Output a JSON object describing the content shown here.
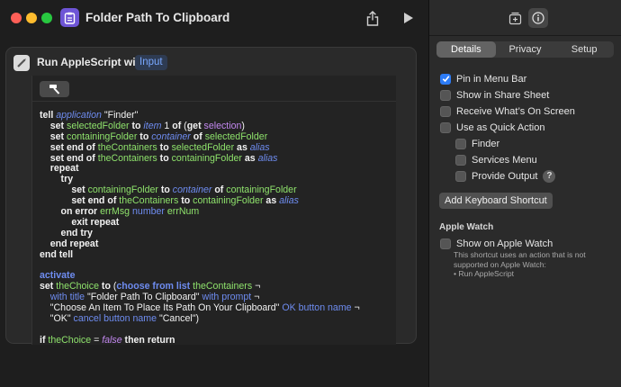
{
  "window": {
    "title": "Folder Path To Clipboard"
  },
  "action": {
    "title": "Run AppleScript with",
    "input_token": "Input"
  },
  "code": {
    "lines": [
      [
        {
          "t": "tell ",
          "c": "kw"
        },
        {
          "t": "application",
          "c": "ap"
        },
        {
          "t": " \"Finder\"",
          "c": ""
        }
      ],
      [
        {
          "t": "    set ",
          "c": "kw"
        },
        {
          "t": "selectedFolder",
          "c": "var"
        },
        {
          "t": " to ",
          "c": "kw"
        },
        {
          "t": "item",
          "c": "cls"
        },
        {
          "t": " 1 ",
          "c": ""
        },
        {
          "t": "of",
          "c": "kw"
        },
        {
          "t": " (",
          "c": ""
        },
        {
          "t": "get",
          "c": "kw"
        },
        {
          "t": " ",
          "c": ""
        },
        {
          "t": "selection",
          "c": "prop"
        },
        {
          "t": ")",
          "c": ""
        }
      ],
      [
        {
          "t": "    set ",
          "c": "kw"
        },
        {
          "t": "containingFolder",
          "c": "var"
        },
        {
          "t": " to ",
          "c": "kw"
        },
        {
          "t": "container",
          "c": "cls"
        },
        {
          "t": " of ",
          "c": "kw"
        },
        {
          "t": "selectedFolder",
          "c": "var"
        }
      ],
      [
        {
          "t": "    set end of ",
          "c": "kw"
        },
        {
          "t": "theContainers",
          "c": "var"
        },
        {
          "t": " to ",
          "c": "kw"
        },
        {
          "t": "selectedFolder",
          "c": "var"
        },
        {
          "t": " as ",
          "c": "kw"
        },
        {
          "t": "alias",
          "c": "cls"
        }
      ],
      [
        {
          "t": "    set end of ",
          "c": "kw"
        },
        {
          "t": "theContainers",
          "c": "var"
        },
        {
          "t": " to ",
          "c": "kw"
        },
        {
          "t": "containingFolder",
          "c": "var"
        },
        {
          "t": " as ",
          "c": "kw"
        },
        {
          "t": "alias",
          "c": "cls"
        }
      ],
      [
        {
          "t": "    repeat",
          "c": "kw"
        }
      ],
      [
        {
          "t": "        try",
          "c": "kw"
        }
      ],
      [
        {
          "t": "            set ",
          "c": "kw"
        },
        {
          "t": "containingFolder",
          "c": "var"
        },
        {
          "t": " to ",
          "c": "kw"
        },
        {
          "t": "container",
          "c": "cls"
        },
        {
          "t": " of ",
          "c": "kw"
        },
        {
          "t": "containingFolder",
          "c": "var"
        }
      ],
      [
        {
          "t": "            set end of ",
          "c": "kw"
        },
        {
          "t": "theContainers",
          "c": "var"
        },
        {
          "t": " to ",
          "c": "kw"
        },
        {
          "t": "containingFolder",
          "c": "var"
        },
        {
          "t": " as ",
          "c": "kw"
        },
        {
          "t": "alias",
          "c": "cls"
        }
      ],
      [
        {
          "t": "        on error ",
          "c": "kw"
        },
        {
          "t": "errMsg",
          "c": "var"
        },
        {
          "t": " ",
          "c": ""
        },
        {
          "t": "number",
          "c": "par"
        },
        {
          "t": " ",
          "c": ""
        },
        {
          "t": "errNum",
          "c": "var"
        }
      ],
      [
        {
          "t": "            exit repeat",
          "c": "kw"
        }
      ],
      [
        {
          "t": "        end try",
          "c": "kw"
        }
      ],
      [
        {
          "t": "    end repeat",
          "c": "kw"
        }
      ],
      [
        {
          "t": "end tell",
          "c": "kw"
        }
      ],
      [
        {
          "t": "",
          "c": ""
        }
      ],
      [
        {
          "t": "activate",
          "c": "cmd"
        }
      ],
      [
        {
          "t": "set ",
          "c": "kw"
        },
        {
          "t": "theChoice",
          "c": "var"
        },
        {
          "t": " to ",
          "c": "kw"
        },
        {
          "t": "(",
          "c": ""
        },
        {
          "t": "choose from list",
          "c": "cmd"
        },
        {
          "t": " ",
          "c": ""
        },
        {
          "t": "theContainers",
          "c": "var"
        },
        {
          "t": " ¬",
          "c": ""
        }
      ],
      [
        {
          "t": "    ",
          "c": ""
        },
        {
          "t": "with title",
          "c": "par"
        },
        {
          "t": " \"Folder Path To Clipboard\" ",
          "c": ""
        },
        {
          "t": "with prompt",
          "c": "par"
        },
        {
          "t": " ¬",
          "c": ""
        }
      ],
      [
        {
          "t": "    \"Choose An Item To Place Its Path On Your Clipboard\" ",
          "c": ""
        },
        {
          "t": "OK button name",
          "c": "par"
        },
        {
          "t": " ¬",
          "c": ""
        }
      ],
      [
        {
          "t": "    \"OK\" ",
          "c": ""
        },
        {
          "t": "cancel button name",
          "c": "par"
        },
        {
          "t": " \"Cancel\")",
          "c": ""
        }
      ],
      [
        {
          "t": "",
          "c": ""
        }
      ],
      [
        {
          "t": "if ",
          "c": "kw"
        },
        {
          "t": "theChoice",
          "c": "var"
        },
        {
          "t": " = ",
          "c": ""
        },
        {
          "t": "false",
          "c": "val"
        },
        {
          "t": " then return",
          "c": "kw"
        }
      ]
    ]
  },
  "inspector": {
    "tabs": [
      {
        "label": "Details",
        "active": true
      },
      {
        "label": "Privacy",
        "active": false
      },
      {
        "label": "Setup",
        "active": false
      }
    ],
    "options": [
      {
        "label": "Pin in Menu Bar",
        "checked": true,
        "indent": 0
      },
      {
        "label": "Show in Share Sheet",
        "checked": false,
        "indent": 0
      },
      {
        "label": "Receive What’s On Screen",
        "checked": false,
        "indent": 0
      },
      {
        "label": "Use as Quick Action",
        "checked": false,
        "indent": 0
      },
      {
        "label": "Finder",
        "checked": false,
        "indent": 1
      },
      {
        "label": "Services Menu",
        "checked": false,
        "indent": 1
      },
      {
        "label": "Provide Output",
        "checked": false,
        "indent": 1,
        "help": true
      }
    ],
    "keyboard_shortcut_button": "Add Keyboard Shortcut",
    "apple_watch": {
      "heading": "Apple Watch",
      "option": {
        "label": "Show on Apple Watch",
        "checked": false
      },
      "note": [
        "This shortcut uses an action that is not",
        "supported on Apple Watch:",
        "• Run AppleScript"
      ]
    },
    "help_glyph": "?"
  },
  "colors": {
    "accent": "#2d7cf6",
    "variable": "#8fe36c",
    "keyword_blue": "#6e8cf0",
    "property_purple": "#c388f0"
  }
}
